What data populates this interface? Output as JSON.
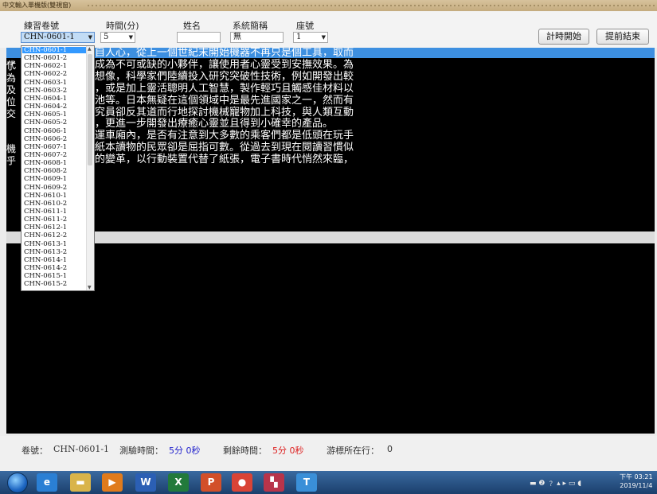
{
  "window": {
    "title": "中文輸入單機版(雙視窗)"
  },
  "form": {
    "practice_label": "練習卷號",
    "time_label": "時間(分)",
    "name_label": "姓名",
    "system_label": "系統簡稱",
    "seat_label": "座號",
    "practice_value": "CHN-0601-1",
    "time_value": "5",
    "name_value": "",
    "system_value": "無",
    "seat_value": "1"
  },
  "buttons": {
    "start": "計時開始",
    "submit": "提前結束"
  },
  "upper_text": {
    "lines": [
      "自人心，從上一個世紀末開始機器不再只是個工具，取而",
      "成為不可或缺的小夥伴，讓使用者心靈受到安撫效果。為",
      "想像，科學家們陸續投入研究突破性技術，例如開發出較",
      "，或是加上靈活聰明人工智慧，製作輕巧且觸感佳材料以",
      "池等。日本無疑在這個領域中是最先進國家之一，然而有",
      "究員卻反其道而行地探討機械寵物加上科技，與人類互動",
      "，更進一步開發出療癒心靈並且得到小確幸的產品。",
      "運車廂內，是否有注意到大多數的乘客們都是低頭在玩手",
      "紙本讀物的民眾卻是屈指可數。從過去到現在閱讀習慣似",
      "的變革，以行動裝置代替了紙張，電子書時代悄然來臨，"
    ],
    "left_fragments": [
      "代",
      "了",
      "為",
      "及",
      "位",
      "交",
      "",
      "",
      "機",
      "乎"
    ]
  },
  "dropdown": {
    "items": [
      "CHN-0601-1",
      "CHN-0601-2",
      "CHN-0602-1",
      "CHN-0602-2",
      "CHN-0603-1",
      "CHN-0603-2",
      "CHN-0604-1",
      "CHN-0604-2",
      "CHN-0605-1",
      "CHN-0605-2",
      "CHN-0606-1",
      "CHN-0606-2",
      "CHN-0607-1",
      "CHN-0607-2",
      "CHN-0608-1",
      "CHN-0608-2",
      "CHN-0609-1",
      "CHN-0609-2",
      "CHN-0610-1",
      "CHN-0610-2",
      "CHN-0611-1",
      "CHN-0611-2",
      "CHN-0612-1",
      "CHN-0612-2",
      "CHN-0613-1",
      "CHN-0613-2",
      "CHN-0614-1",
      "CHN-0614-2",
      "CHN-0615-1",
      "CHN-0615-2"
    ]
  },
  "status": {
    "volume_label": "卷號：",
    "volume_value": "CHN-0601-1",
    "test_time_label": "測驗時間：",
    "test_time_value": "5分 0秒",
    "remaining_label": "剩餘時間：",
    "remaining_value": "5分 0秒",
    "cursor_label": "游標所在行：",
    "cursor_value": "0"
  },
  "taskbar": {
    "apps": [
      {
        "icon": "ie-icon",
        "glyph": "e",
        "color": "#2a7fd4"
      },
      {
        "icon": "folder-icon",
        "glyph": "▬",
        "color": "#d9b44a"
      },
      {
        "icon": "media-player-icon",
        "glyph": "▶",
        "color": "#e07b1c"
      },
      {
        "icon": "word-icon",
        "glyph": "W",
        "color": "#2b5fb4"
      },
      {
        "icon": "excel-icon",
        "glyph": "X",
        "color": "#227a3b"
      },
      {
        "icon": "powerpoint-icon",
        "glyph": "P",
        "color": "#d2502a"
      },
      {
        "icon": "chrome-icon",
        "glyph": "●",
        "color": "#d94436"
      },
      {
        "icon": "flag-app-icon",
        "glyph": "▚",
        "color": "#b8344a"
      },
      {
        "icon": "typing-app-icon",
        "glyph": "T",
        "color": "#3a8fd8"
      }
    ],
    "tray": "▬ ❷ ﹖ ▴ ▸ ▭ ◖",
    "time": "下午 03:21",
    "date": "2019/11/4"
  }
}
